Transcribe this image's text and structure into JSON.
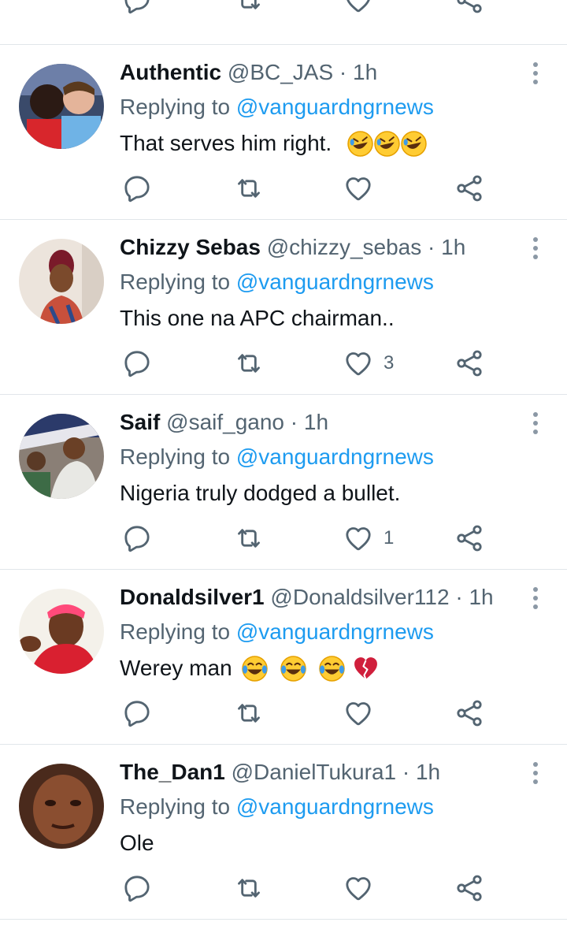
{
  "colors": {
    "primary_text": "#0f1419",
    "secondary_text": "#536471",
    "link": "#1d9bf0",
    "divider": "#e1e6ea",
    "background": "#ffffff"
  },
  "top_actions": {
    "like_count": ""
  },
  "replies": [
    {
      "display_name": "Authentic",
      "handle": "@BC_JAS",
      "separator": "·",
      "time": "1h",
      "replying_prefix": "Replying to",
      "replying_to": "@vanguardngrnews",
      "text": "That serves him right.",
      "emojis": [
        "rofl-emoji",
        "rofl-emoji",
        "rofl-emoji"
      ],
      "like_count": ""
    },
    {
      "display_name": "Chizzy Sebas",
      "handle": "@chizzy_sebas",
      "separator": "·",
      "time": "1h",
      "replying_prefix": "Replying to",
      "replying_to": "@vanguardngrnews",
      "text": "This one na APC chairman..",
      "emojis": [],
      "like_count": "3"
    },
    {
      "display_name": "Saif",
      "handle": "@saif_gano",
      "separator": "·",
      "time": "1h",
      "replying_prefix": "Replying to",
      "replying_to": "@vanguardngrnews",
      "text": "Nigeria truly dodged a bullet.",
      "emojis": [],
      "like_count": "1"
    },
    {
      "display_name": "Donaldsilver1",
      "handle": "@Donaldsilver112",
      "separator": "·",
      "time": "1h",
      "replying_prefix": "Replying to",
      "replying_to": "@vanguardngrnews",
      "text": "Werey man",
      "emojis": [
        "joy-emoji",
        "joy-emoji",
        "joy-emoji",
        "broken-heart-emoji"
      ],
      "like_count": ""
    },
    {
      "display_name": "The_Dan1",
      "handle": "@DanielTukura1",
      "separator": "·",
      "time": "1h",
      "replying_prefix": "Replying to",
      "replying_to": "@vanguardngrnews",
      "text": "Ole",
      "emojis": [],
      "like_count": ""
    }
  ],
  "icons": {
    "reply": "reply-icon",
    "retweet": "retweet-icon",
    "like": "heart-icon",
    "share": "share-icon",
    "more": "more-vertical-icon"
  }
}
